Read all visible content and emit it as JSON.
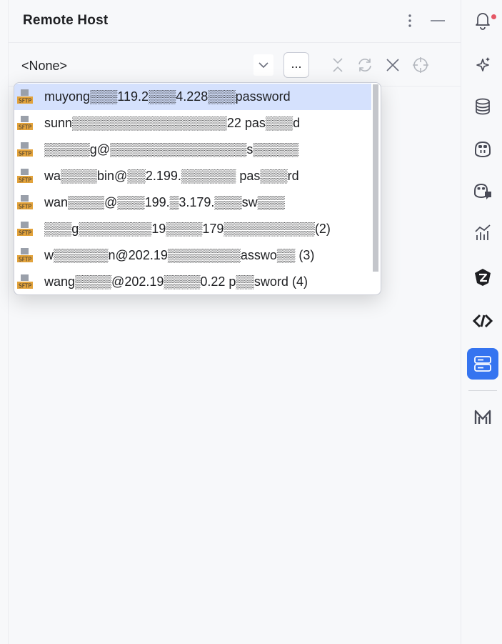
{
  "panel": {
    "title": "Remote Host",
    "more_icon": "vertical-ellipsis-icon",
    "minimize_icon": "minimize-icon"
  },
  "toolbar": {
    "selected_host": "<None>",
    "browse_label": "...",
    "icons": [
      "collapse-icon",
      "refresh-icon",
      "close-icon",
      "target-icon"
    ]
  },
  "dropdown": {
    "items": [
      {
        "label": "muyong▒▒▒119.2▒▒▒4.228▒▒▒password",
        "icon": "sftp-icon",
        "selected": true
      },
      {
        "label": "sunn▒▒▒▒▒▒▒▒▒▒▒▒▒▒▒▒▒22 pas▒▒▒d",
        "icon": "sftp-icon",
        "selected": false
      },
      {
        "label": "▒▒▒▒▒g@▒▒▒▒▒▒▒▒▒▒▒▒▒▒▒s▒▒▒▒▒",
        "icon": "sftp-icon",
        "selected": false
      },
      {
        "label": "wa▒▒▒▒bin@▒▒2.199.▒▒▒▒▒▒ pas▒▒▒rd",
        "icon": "sftp-icon",
        "selected": false
      },
      {
        "label": "wan▒▒▒▒@▒▒▒199.▒3.179.▒▒▒sw▒▒▒",
        "icon": "sftp-icon",
        "selected": false
      },
      {
        "label": "▒▒▒g▒▒▒▒▒▒▒▒19▒▒▒▒179▒▒▒▒▒▒▒▒▒▒(2)",
        "icon": "sftp-icon",
        "selected": false
      },
      {
        "label": "w▒▒▒▒▒▒n@202.19▒▒▒▒▒▒▒▒asswo▒▒ (3)",
        "icon": "sftp-icon",
        "selected": false
      },
      {
        "label": "wang▒▒▒▒@202.19▒▒▒▒0.22 p▒▒sword (4)",
        "icon": "sftp-icon",
        "selected": false
      }
    ]
  },
  "right_toolbar": {
    "buttons": [
      {
        "name": "notifications-icon",
        "has_badge": true
      },
      {
        "name": "ai-assistant-icon"
      },
      {
        "name": "database-icon"
      },
      {
        "name": "copilot-icon"
      },
      {
        "name": "copilot-chat-icon"
      },
      {
        "name": "profiler-icon"
      },
      {
        "name": "plugin-icon"
      },
      {
        "name": "code-with-me-icon"
      },
      {
        "name": "remote-host-icon",
        "active": true
      },
      {
        "name": "markdown-m-icon"
      }
    ]
  },
  "colors": {
    "accent": "#3574f0",
    "selection": "#d5e1fd",
    "badge": "#e55765"
  }
}
